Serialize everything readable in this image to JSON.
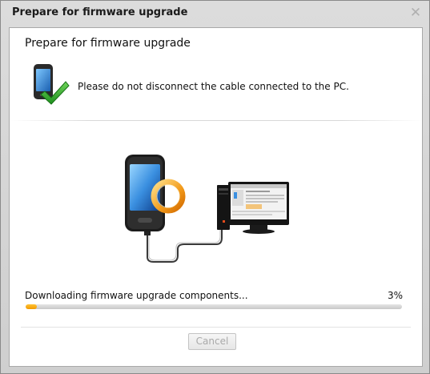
{
  "window": {
    "title": "Prepare for firmware upgrade",
    "close_icon": "close-icon",
    "close_glyph": "✕"
  },
  "content": {
    "heading": "Prepare for firmware upgrade",
    "status_icon": "phone-check-icon",
    "instruction": "Please do not disconnect the cable connected to the PC.",
    "illustration": "phone-connected-to-pc-illustration"
  },
  "progress": {
    "label": "Downloading firmware upgrade components...",
    "percent_text": "3%",
    "value": 0.03,
    "fill_color": "#f5a30a"
  },
  "buttons": {
    "cancel_label": "Cancel",
    "cancel_enabled": false
  }
}
